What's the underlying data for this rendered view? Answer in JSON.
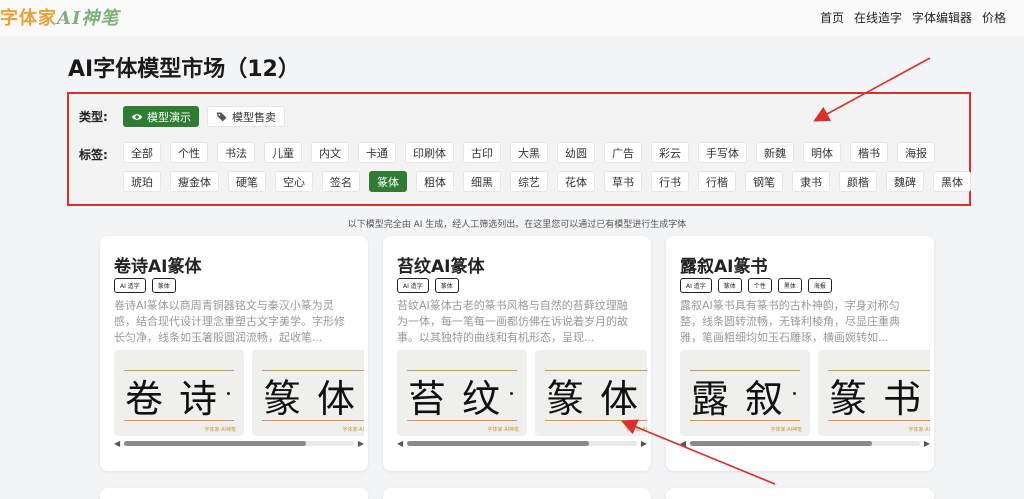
{
  "header": {
    "logo_main": "字体家",
    "logo_ai": "AI神笔",
    "nav": [
      "首页",
      "在线造字",
      "字体编辑器",
      "价格"
    ]
  },
  "page_title": "AI字体模型市场（12）",
  "filters": {
    "type_label": "类型:",
    "types": [
      {
        "label": "模型演示",
        "icon": "eye-icon",
        "active": true
      },
      {
        "label": "模型售卖",
        "icon": "tags-icon",
        "active": false
      }
    ],
    "tag_label": "标签:",
    "tags": [
      "全部",
      "个性",
      "书法",
      "儿童",
      "内文",
      "卡通",
      "印刷体",
      "古印",
      "大黑",
      "幼圆",
      "广告",
      "彩云",
      "手写体",
      "新魏",
      "明体",
      "楷书",
      "海报",
      "琥珀",
      "瘦金体",
      "硬笔",
      "空心",
      "签名",
      "篆体",
      "粗体",
      "细黑",
      "综艺",
      "花体",
      "草书",
      "行书",
      "行楷",
      "钢笔",
      "隶书",
      "颜楷",
      "魏碑",
      "黑体"
    ],
    "active_tag": "篆体"
  },
  "note": "以下模型完全由 AI 生成，经人工筛选列出。在这里您可以通过已有模型进行生成字体",
  "cards": [
    {
      "title": "卷诗AI篆体",
      "tags": [
        "AI 造字",
        "篆体"
      ],
      "desc": "卷诗AI篆体以商周青铜器铭文与秦汉小篆为灵感，结合现代设计理念重塑古文字美学。字形修长匀净，线条如玉箸般圆润流畅，起收笔...",
      "samples": [
        "卷诗",
        "篆体"
      ]
    },
    {
      "title": "苔纹AI篆体",
      "tags": [
        "AI 造字",
        "篆体"
      ],
      "desc": "苔纹AI篆体古老的篆书风格与自然的苔藓纹理融为一体，每一笔每一画都仿佛在诉说着岁月的故事。以其独特的曲线和有机形态，呈现...",
      "samples": [
        "苔纹",
        "篆体"
      ]
    },
    {
      "title": "露叙AI篆书",
      "tags": [
        "AI 造字",
        "篆体",
        "个性",
        "黑体",
        "海报"
      ],
      "desc": "露叙AI篆书具有篆书的古朴神韵，字身对称匀整，线条圆转流畅，无锋利棱角，尽显庄重典雅，笔画粗细均如玉石雕琢，横画婉转如...",
      "samples": [
        "露叙",
        "篆书"
      ]
    }
  ],
  "watermark": "字体家·AI神笔",
  "colors": {
    "accent_green": "#2e7d32",
    "highlight_red": "#d9302c"
  }
}
